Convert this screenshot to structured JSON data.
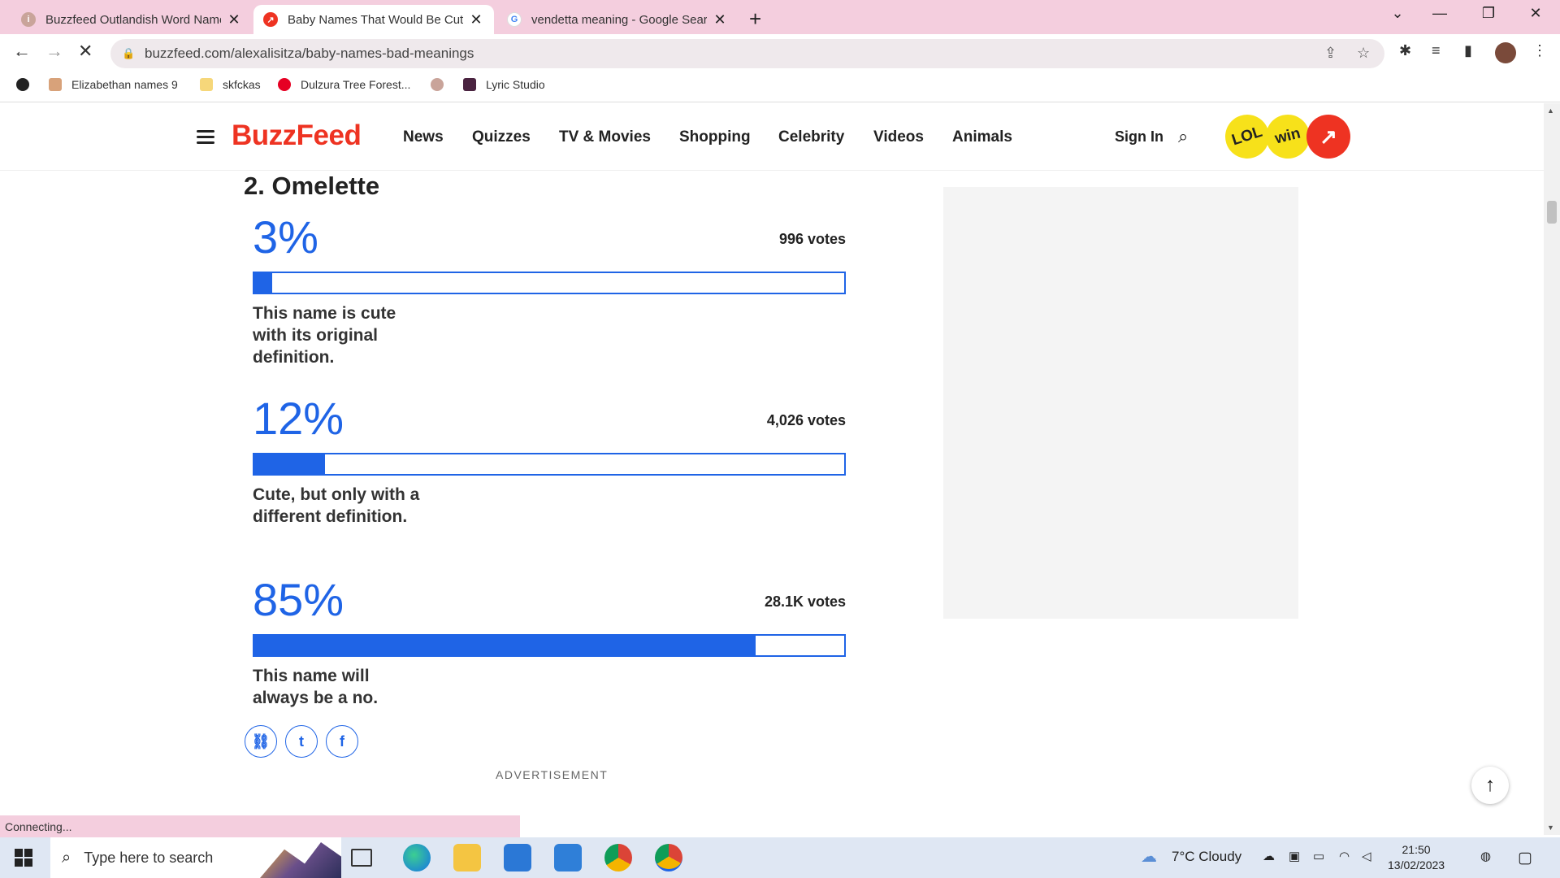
{
  "browser": {
    "tabs": [
      {
        "title": "Buzzfeed Outlandish Word Name",
        "active": false
      },
      {
        "title": "Baby Names That Would Be Cute",
        "active": true
      },
      {
        "title": "vendetta meaning - Google Sear",
        "active": false
      }
    ],
    "new_tab_glyph": "+",
    "url": "buzzfeed.com/alexalisitza/baby-names-bad-meanings",
    "bookmarks": [
      "Elizabethan names 9",
      "skfckas",
      "Dulzura Tree Forest...",
      "Lyric Studio"
    ],
    "status_text": "Connecting..."
  },
  "site": {
    "logo": "BuzzFeed",
    "nav": [
      "News",
      "Quizzes",
      "TV & Movies",
      "Shopping",
      "Celebrity",
      "Videos",
      "Animals"
    ],
    "sign_in": "Sign In",
    "badges": [
      "LOL",
      "win"
    ],
    "accent_color": "#1f64e6",
    "brand_color": "#ee3322"
  },
  "poll": {
    "title": "2. Omelette",
    "options": [
      {
        "percent_text": "3%",
        "percent": 3,
        "votes": "996 votes",
        "label": "This name is cute with its original definition."
      },
      {
        "percent_text": "12%",
        "percent": 12,
        "votes": "4,026 votes",
        "label": "Cute, but only with a different definition."
      },
      {
        "percent_text": "85%",
        "percent": 85,
        "votes": "28.1K votes",
        "label": "This name will always be a no."
      }
    ]
  },
  "advertisement_label": "ADVERTISEMENT",
  "taskbar": {
    "search_placeholder": "Type here to search",
    "weather": "7°C  Cloudy",
    "time": "21:50",
    "date": "13/02/2023"
  }
}
